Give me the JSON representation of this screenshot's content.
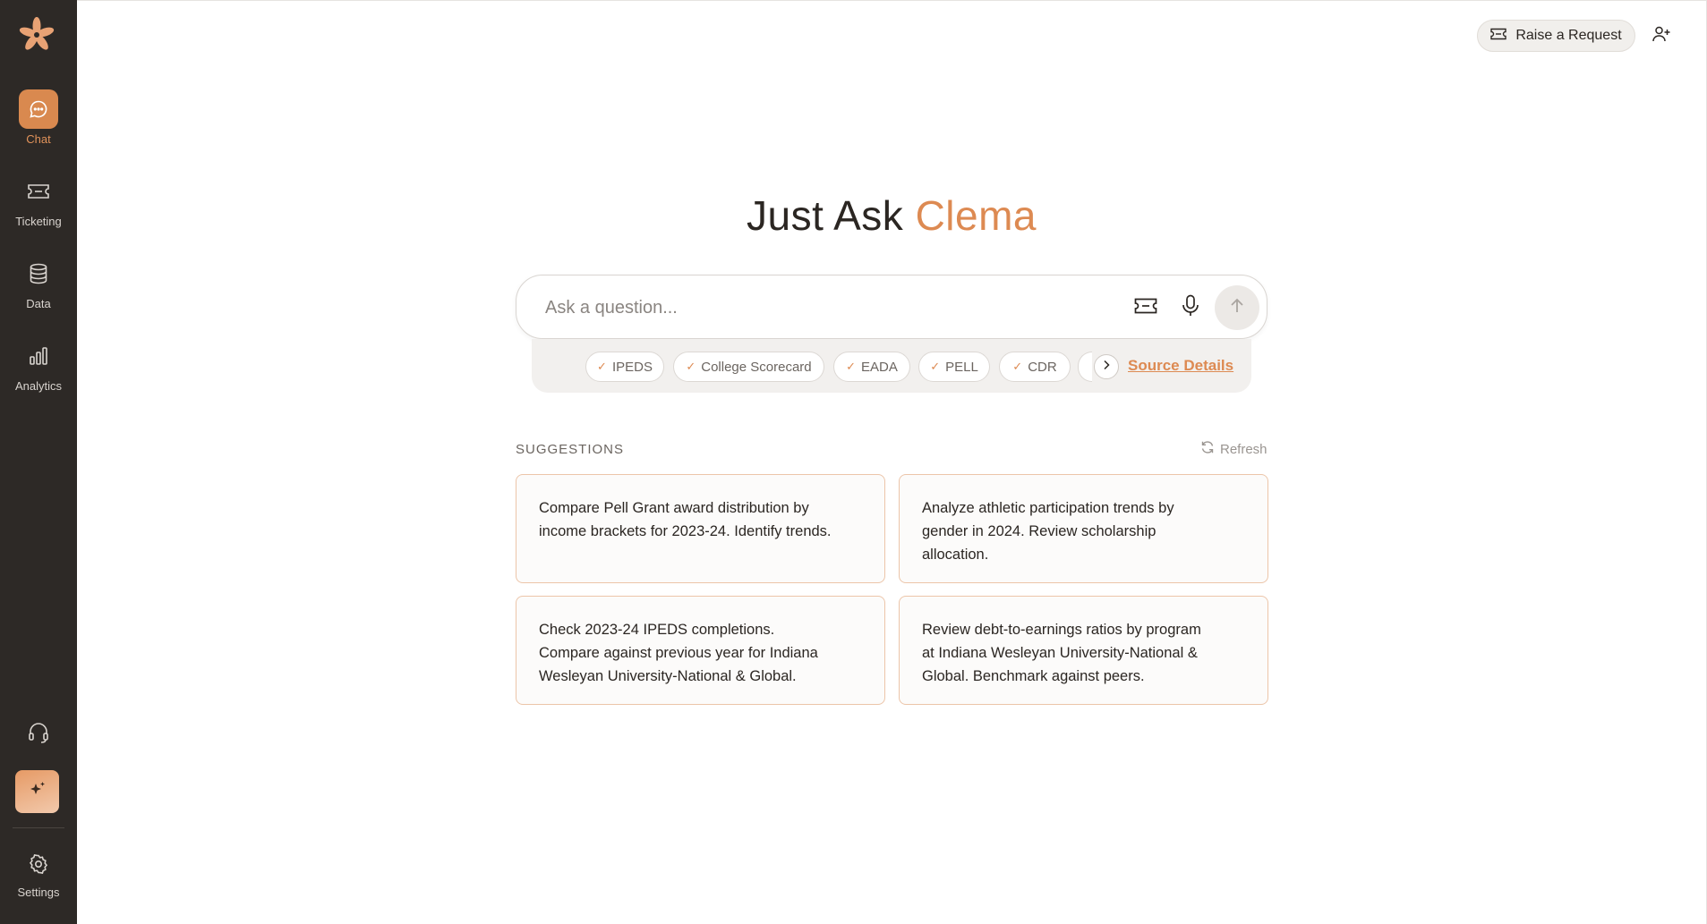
{
  "app": {
    "brand_color": "#dd8a52",
    "sidebar_color": "#2d2926"
  },
  "sidebar": {
    "items": [
      {
        "label": "Chat",
        "icon": "chat-bubble-icon",
        "active": true
      },
      {
        "label": "Ticketing",
        "icon": "ticket-icon",
        "active": false
      },
      {
        "label": "Data",
        "icon": "database-icon",
        "active": false
      },
      {
        "label": "Analytics",
        "icon": "bar-chart-icon",
        "active": false
      }
    ],
    "settings_label": "Settings"
  },
  "header": {
    "raise_request_label": "Raise a Request"
  },
  "main": {
    "title_prefix": "Just Ask",
    "title_accent": "Clema",
    "search": {
      "placeholder": "Ask a question...",
      "value": ""
    },
    "sources": [
      {
        "label": "IPEDS",
        "selected": true
      },
      {
        "label": "College Scorecard",
        "selected": true
      },
      {
        "label": "EADA",
        "selected": true
      },
      {
        "label": "PELL",
        "selected": true
      },
      {
        "label": "CDR",
        "selected": true
      }
    ],
    "source_details_label": "Source Details",
    "suggestions_heading": "SUGGESTIONS",
    "refresh_label": "Refresh",
    "suggestions": [
      "Compare Pell Grant award distribution by income brackets for 2023-24. Identify trends.",
      "Analyze athletic participation trends by gender in 2024. Review scholarship allocation.",
      "Check 2023-24 IPEDS completions. Compare against previous year for Indiana Wesleyan University-National & Global.",
      "Review debt-to-earnings ratios by program at Indiana Wesleyan University-National & Global. Benchmark against peers."
    ]
  }
}
